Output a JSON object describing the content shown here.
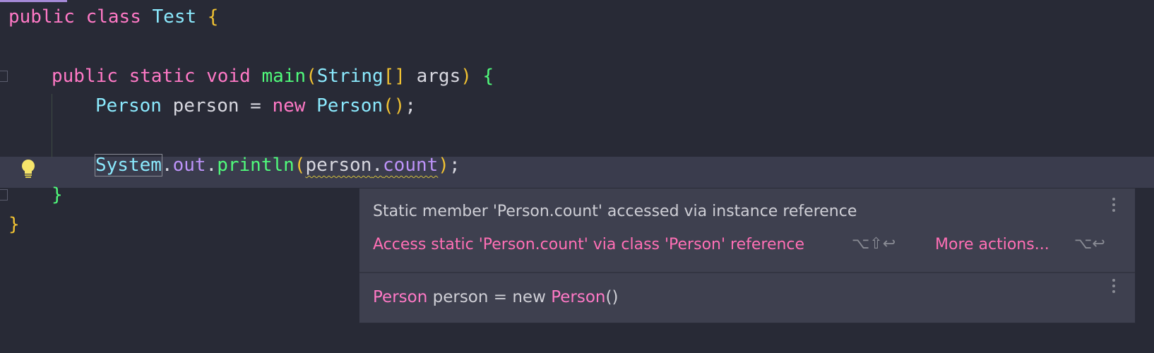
{
  "code": {
    "line1": {
      "kw1": "public",
      "kw2": "class",
      "cls": "Test",
      "brace": "{"
    },
    "line3": {
      "kw1": "public",
      "kw2": "static",
      "kw3": "void",
      "fn": "main",
      "p1": "(",
      "type": "String",
      "arr": "[]",
      "arg": "args",
      "p2": ")",
      "brace": "{"
    },
    "line4": {
      "type": "Person",
      "var": "person",
      "eq": "=",
      "kw": "new",
      "ctor": "Person",
      "paren": "()",
      "semi": ";"
    },
    "line6": {
      "cls": "System",
      "dot1": ".",
      "field": "out",
      "dot2": ".",
      "fn": "println",
      "p1": "(",
      "obj": "person",
      "dot3": ".",
      "member": "count",
      "p2": ")",
      "semi": ";"
    },
    "line7": {
      "brace": "}"
    },
    "line8": {
      "brace": "}"
    }
  },
  "popup": {
    "message": "Static member 'Person.count' accessed via instance reference",
    "action": "Access static 'Person.count' via class 'Person' reference",
    "action_shortcut": "⌥⇧↩",
    "more_actions": "More actions...",
    "more_shortcut": "⌥↩",
    "declaration": {
      "type": "Person",
      "rest": " person = new ",
      "ctor": "Person",
      "paren": "()"
    }
  },
  "colors": {
    "accent": "#ff79c6",
    "background": "#282a36",
    "popup_bg": "#3e404f"
  }
}
